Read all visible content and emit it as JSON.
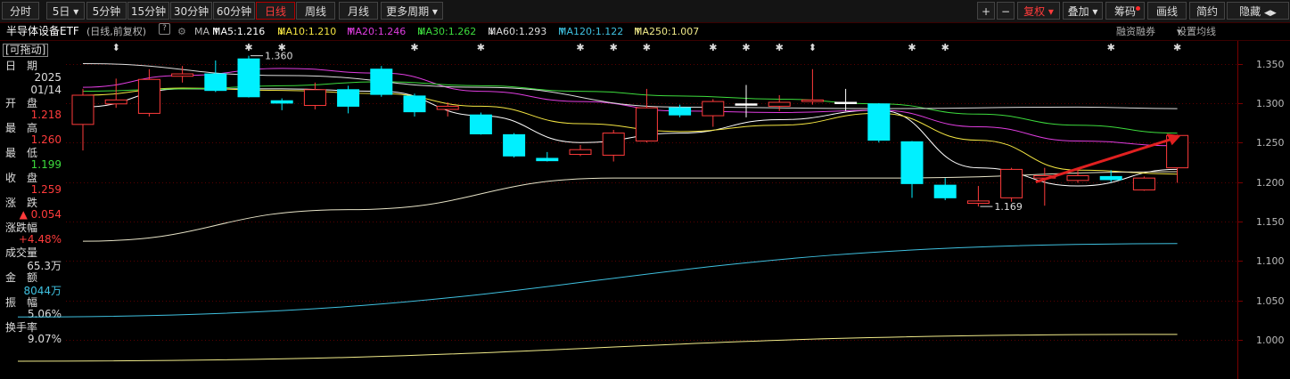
{
  "toolbar": {
    "periods": [
      "分时",
      "5日",
      "5分钟",
      "15分钟",
      "30分钟",
      "60分钟",
      "日线",
      "周线",
      "月线",
      "更多周期"
    ],
    "period_dropdown_arrow": "▾",
    "right_buttons": [
      "+",
      "−",
      "复权",
      "叠加",
      "筹码",
      "画线",
      "简约",
      "隐藏"
    ],
    "hide_arrows": "◀▶"
  },
  "info": {
    "name": "半导体设备ETF",
    "period_desc": "(日线,前复权)",
    "help": "?",
    "ma_label": "MA",
    "ma": [
      {
        "text": "MA5:1.216",
        "arrow": "↑",
        "color": "#ffffff"
      },
      {
        "text": "MA10:1.210",
        "arrow": "↓",
        "color": "#f5e642"
      },
      {
        "text": "MA20:1.246",
        "arrow": "↑",
        "color": "#e03de0"
      },
      {
        "text": "MA30:1.262",
        "arrow": "↓",
        "color": "#3ddc3d"
      },
      {
        "text": "MA60:1.293",
        "arrow": "↓",
        "color": "#dddddd"
      },
      {
        "text": "MA120:1.122",
        "arrow": "↑",
        "color": "#3fc1e0"
      },
      {
        "text": "MA250:1.007",
        "arrow": "↑",
        "color": "#f2ec8a"
      }
    ],
    "margin": "融资融券",
    "set_ma": "设置均线"
  },
  "panel": {
    "drag": "[可拖动]",
    "date_label": "日　期",
    "date_year": "2025",
    "date_md": "01/14",
    "open_label": "开　盘",
    "open": "1.218",
    "high_label": "最　高",
    "high": "1.260",
    "low_label": "最　低",
    "low": "1.199",
    "close_label": "收　盘",
    "close": "1.259",
    "chg_label": "涨　跌",
    "chg": "▲ 0.054",
    "pct_label": "涨跌幅",
    "pct": "+4.48%",
    "vol_label": "成交量",
    "vol": "65.3万",
    "amt_label": "金　额",
    "amt": "8044万",
    "amp_label": "振　幅",
    "amp": "5.06%",
    "turn_label": "换手率",
    "turn": "9.07%"
  },
  "colors": {
    "up": "#ff3b3b",
    "down": "#00f0ff",
    "flat": "#ffffff",
    "amt": "#3fc1e0",
    "green": "#3ddc3d",
    "arrow": "#e02020"
  },
  "chart_data": {
    "type": "candlestick",
    "y_ticks": [
      "1.350",
      "1.300",
      "1.250",
      "1.200",
      "1.150",
      "1.100",
      "1.050",
      "1.000"
    ],
    "ylim": [
      0.982,
      1.372
    ],
    "annotations": [
      {
        "text": "1.360",
        "at": "high"
      },
      {
        "text": "1.169",
        "at": "low"
      }
    ],
    "event_marker_star": "✱",
    "event_marker_arrow": "⬍",
    "candles": [
      {
        "o": 1.273,
        "c": 1.31,
        "h": 1.318,
        "l": 1.24
      },
      {
        "o": 1.299,
        "c": 1.304,
        "h": 1.331,
        "l": 1.294
      },
      {
        "o": 1.287,
        "c": 1.33,
        "h": 1.343,
        "l": 1.283
      },
      {
        "o": 1.334,
        "c": 1.337,
        "h": 1.347,
        "l": 1.326
      },
      {
        "o": 1.337,
        "c": 1.316,
        "h": 1.354,
        "l": 1.314
      },
      {
        "o": 1.356,
        "c": 1.308,
        "h": 1.36,
        "l": 1.307
      },
      {
        "o": 1.303,
        "c": 1.3,
        "h": 1.306,
        "l": 1.291
      },
      {
        "o": 1.297,
        "c": 1.317,
        "h": 1.326,
        "l": 1.292
      },
      {
        "o": 1.317,
        "c": 1.296,
        "h": 1.322,
        "l": 1.287
      },
      {
        "o": 1.343,
        "c": 1.311,
        "h": 1.347,
        "l": 1.308
      },
      {
        "o": 1.309,
        "c": 1.289,
        "h": 1.312,
        "l": 1.283
      },
      {
        "o": 1.292,
        "c": 1.296,
        "h": 1.301,
        "l": 1.283
      },
      {
        "o": 1.285,
        "c": 1.261,
        "h": 1.288,
        "l": 1.26
      },
      {
        "o": 1.26,
        "c": 1.233,
        "h": 1.262,
        "l": 1.231
      },
      {
        "o": 1.23,
        "c": 1.227,
        "h": 1.238,
        "l": 1.226
      },
      {
        "o": 1.235,
        "c": 1.241,
        "h": 1.247,
        "l": 1.233
      },
      {
        "o": 1.234,
        "c": 1.262,
        "h": 1.266,
        "l": 1.226
      },
      {
        "o": 1.252,
        "c": 1.294,
        "h": 1.318,
        "l": 1.25
      },
      {
        "o": 1.294,
        "c": 1.285,
        "h": 1.298,
        "l": 1.282
      },
      {
        "o": 1.284,
        "c": 1.302,
        "h": 1.305,
        "l": 1.27
      },
      {
        "o": 1.298,
        "c": 1.299,
        "h": 1.323,
        "l": 1.282
      },
      {
        "o": 1.296,
        "c": 1.301,
        "h": 1.31,
        "l": 1.29
      },
      {
        "o": 1.302,
        "c": 1.304,
        "h": 1.343,
        "l": 1.298
      },
      {
        "o": 1.3,
        "c": 1.301,
        "h": 1.318,
        "l": 1.29
      },
      {
        "o": 1.299,
        "c": 1.253,
        "h": 1.3,
        "l": 1.25
      },
      {
        "o": 1.251,
        "c": 1.198,
        "h": 1.252,
        "l": 1.18
      },
      {
        "o": 1.196,
        "c": 1.18,
        "h": 1.205,
        "l": 1.177
      },
      {
        "o": 1.173,
        "c": 1.176,
        "h": 1.195,
        "l": 1.169
      },
      {
        "o": 1.18,
        "c": 1.216,
        "h": 1.218,
        "l": 1.175
      },
      {
        "o": 1.205,
        "c": 1.208,
        "h": 1.218,
        "l": 1.17
      },
      {
        "o": 1.202,
        "c": 1.208,
        "h": 1.217,
        "l": 1.199
      },
      {
        "o": 1.207,
        "c": 1.203,
        "h": 1.215,
        "l": 1.2
      },
      {
        "o": 1.19,
        "c": 1.205,
        "h": 1.207,
        "l": 1.189
      },
      {
        "o": 1.218,
        "c": 1.259,
        "h": 1.26,
        "l": 1.199
      }
    ],
    "ma_series": [
      {
        "name": "MA5",
        "color": "#ffffff",
        "x": [
          0,
          3,
          6,
          9,
          12,
          15,
          18,
          21,
          24,
          27,
          30,
          33
        ],
        "y": [
          1.295,
          1.318,
          1.318,
          1.315,
          1.284,
          1.25,
          1.262,
          1.279,
          1.291,
          1.218,
          1.195,
          1.216
        ]
      },
      {
        "name": "MA10",
        "color": "#f5e642",
        "x": [
          0,
          3,
          6,
          9,
          12,
          15,
          18,
          21,
          24,
          27,
          30,
          33
        ],
        "y": [
          1.31,
          1.319,
          1.316,
          1.312,
          1.296,
          1.274,
          1.264,
          1.272,
          1.287,
          1.253,
          1.215,
          1.21
        ]
      },
      {
        "name": "MA20",
        "color": "#e03de0",
        "x": [
          0,
          3,
          6,
          9,
          12,
          15,
          18,
          21,
          24,
          27,
          30,
          33
        ],
        "y": [
          1.32,
          1.335,
          1.344,
          1.338,
          1.315,
          1.302,
          1.29,
          1.288,
          1.291,
          1.27,
          1.252,
          1.246
        ]
      },
      {
        "name": "MA30",
        "color": "#3ddc3d",
        "x": [
          0,
          3,
          6,
          9,
          12,
          15,
          18,
          21,
          24,
          27,
          30,
          33
        ],
        "y": [
          1.315,
          1.318,
          1.322,
          1.327,
          1.322,
          1.315,
          1.309,
          1.305,
          1.299,
          1.286,
          1.272,
          1.262
        ]
      },
      {
        "name": "MA60",
        "color": "#dddddd",
        "x": [
          0,
          6,
          12,
          18,
          24,
          30,
          33
        ],
        "y": [
          1.35,
          1.335,
          1.32,
          1.295,
          1.293,
          1.295,
          1.293
        ]
      },
      {
        "name": "MA120",
        "color": "#3fc1e0",
        "x": [
          0,
          33
        ],
        "y": [
          1.029,
          1.122
        ]
      },
      {
        "name": "MA250",
        "color": "#f2ec8a",
        "x": [
          0,
          33
        ],
        "y": [
          0.973,
          1.007
        ]
      },
      {
        "name": "Long",
        "color": "#e8e4c8",
        "x": [
          0,
          8,
          16,
          24,
          33
        ],
        "y": [
          1.125,
          1.165,
          1.205,
          1.205,
          1.213
        ]
      }
    ],
    "event_markers": [
      {
        "i": 1,
        "type": "arrow"
      },
      {
        "i": 5,
        "type": "star"
      },
      {
        "i": 6,
        "type": "star"
      },
      {
        "i": 10,
        "type": "star"
      },
      {
        "i": 12,
        "type": "star"
      },
      {
        "i": 15,
        "type": "star"
      },
      {
        "i": 16,
        "type": "star"
      },
      {
        "i": 17,
        "type": "star"
      },
      {
        "i": 19,
        "type": "star"
      },
      {
        "i": 20,
        "type": "star"
      },
      {
        "i": 21,
        "type": "star"
      },
      {
        "i": 22,
        "type": "arrow"
      },
      {
        "i": 25,
        "type": "star"
      },
      {
        "i": 26,
        "type": "star"
      },
      {
        "i": 31,
        "type": "star"
      },
      {
        "i": 33,
        "type": "star"
      }
    ]
  }
}
